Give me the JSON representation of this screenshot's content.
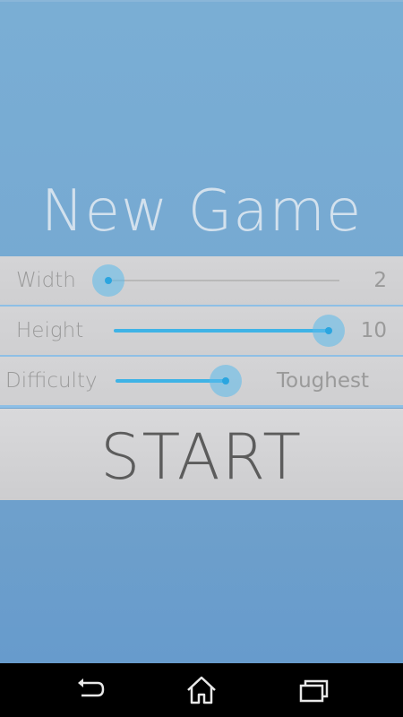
{
  "title": "New Game",
  "settings": [
    {
      "label": "Width",
      "value": "2",
      "level": 0.0
    },
    {
      "label": "Height",
      "value": "10",
      "level": 1.0
    },
    {
      "label": "Difficulty",
      "value": "Toughest",
      "level": 1.0
    }
  ],
  "start_label": "START",
  "colors": {
    "background": "#76a9d2",
    "panel": "#d1d1d3",
    "accent": "#3fb3e6",
    "navbar": "#000000"
  },
  "navbar": {
    "icons": [
      "back-icon",
      "home-icon",
      "recent-apps-icon"
    ]
  }
}
